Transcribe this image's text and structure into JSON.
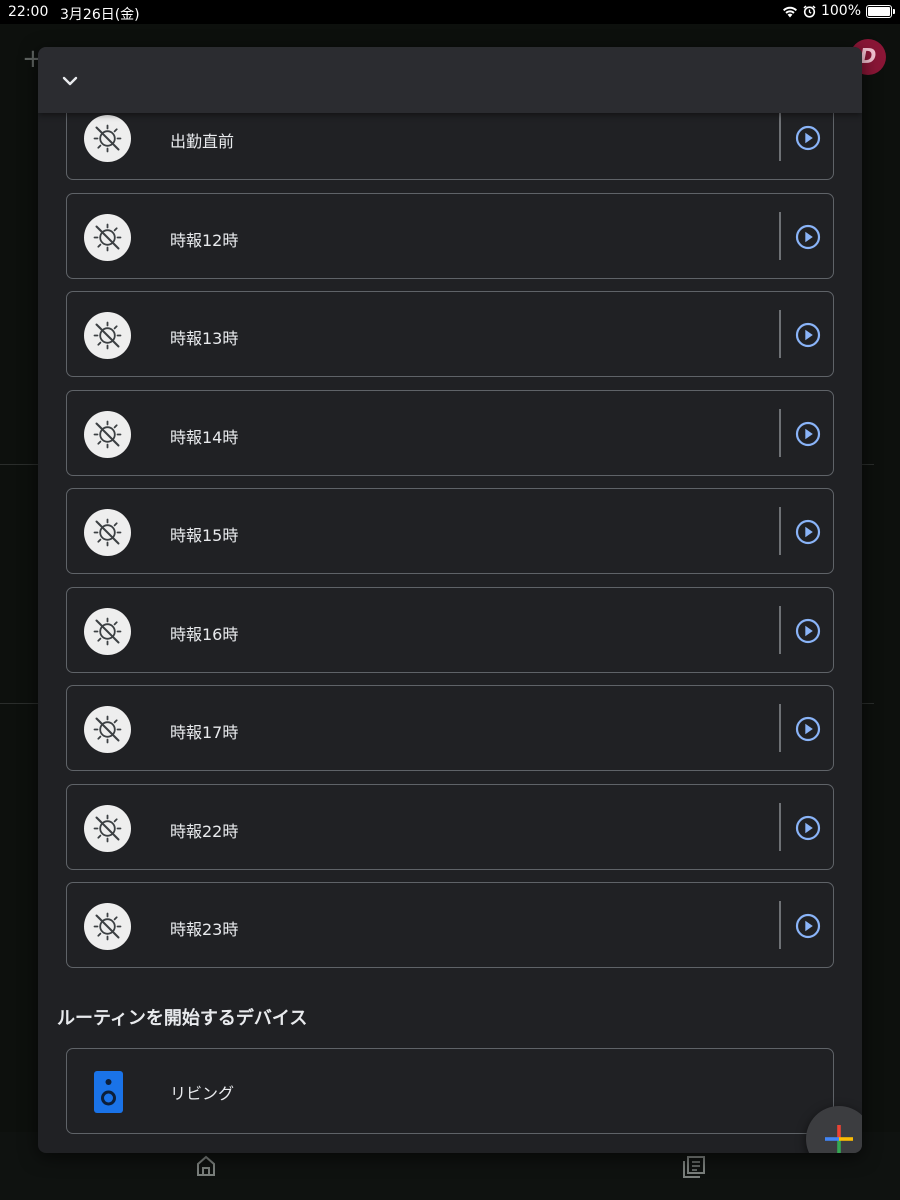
{
  "status_bar": {
    "time": "22:00",
    "date": "3月26日(金)",
    "battery": "100%"
  },
  "background": {
    "avatar_letter": "D"
  },
  "sheet": {
    "routines": [
      {
        "label": "出勤直前"
      },
      {
        "label": "時報12時"
      },
      {
        "label": "時報13時"
      },
      {
        "label": "時報14時"
      },
      {
        "label": "時報15時"
      },
      {
        "label": "時報16時"
      },
      {
        "label": "時報17時"
      },
      {
        "label": "時報22時"
      },
      {
        "label": "時報23時"
      }
    ],
    "devices_section_title": "ルーティンを開始するデバイス",
    "devices": [
      {
        "label": "リビング"
      }
    ]
  },
  "icons": {
    "routine": "sun-off-icon",
    "play": "play-circle-icon",
    "device": "speaker-icon",
    "fab": "add-icon",
    "collapse": "chevron-down-icon"
  },
  "colors": {
    "sheet_bg": "#202124",
    "card_border": "#5f6368",
    "play_accent": "#8ab4f8",
    "speaker_blue": "#1a73e8",
    "fab_blue": "#4285f4",
    "fab_red": "#ea4335",
    "fab_yellow": "#fbbc04",
    "fab_green": "#34a853"
  }
}
